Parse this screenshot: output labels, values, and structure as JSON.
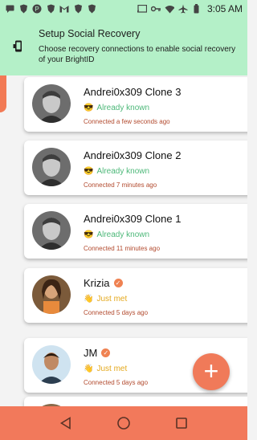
{
  "status_bar": {
    "time": "3:05 AM",
    "left_icons": [
      "message-icon",
      "brave-icon",
      "pinterest-icon",
      "brave-icon",
      "gmail-icon",
      "brave-icon",
      "brave-icon"
    ],
    "right_icons": [
      "cast-icon",
      "key-icon",
      "wifi-icon",
      "airplane-icon",
      "battery-icon"
    ]
  },
  "header": {
    "title": "Setup Social Recovery",
    "description": "Choose recovery connections to enable social recovery of your BrightID"
  },
  "connections": [
    {
      "name": "Andrei0x309 Clone 3",
      "status": "Already known",
      "status_type": "known",
      "emoji": "😎",
      "connected": "Connected a few seconds ago",
      "verified": false
    },
    {
      "name": "Andrei0x309 Clone 2",
      "status": "Already known",
      "status_type": "known",
      "emoji": "😎",
      "connected": "Connected 7 minutes ago",
      "verified": false
    },
    {
      "name": "Andrei0x309 Clone 1",
      "status": "Already known",
      "status_type": "known",
      "emoji": "😎",
      "connected": "Connected 11 minutes ago",
      "verified": false
    },
    {
      "name": "Krizia",
      "status": "Just met",
      "status_type": "met",
      "emoji": "👋",
      "connected": "Connected 5 days ago",
      "verified": true
    },
    {
      "name": "JM",
      "status": "Just met",
      "status_type": "met",
      "emoji": "👋",
      "connected": "Connected 5 days ago",
      "verified": true
    }
  ],
  "fab": {
    "label": "+"
  },
  "colors": {
    "accent": "#f2795b",
    "banner": "#b4f0c8",
    "known": "#4db879",
    "met": "#e4a91e"
  }
}
